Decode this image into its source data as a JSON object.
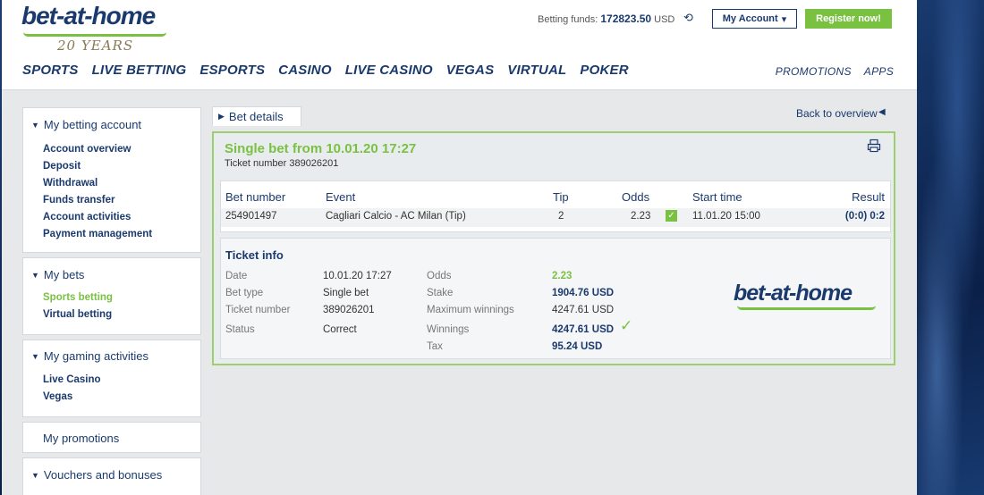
{
  "header": {
    "logo_text": "bet-at-home",
    "logo_years": "20 YEARS",
    "funds_label": "Betting funds:",
    "funds_value": "172823.50",
    "funds_currency": "USD",
    "my_account_label": "My Account",
    "register_label": "Register now!",
    "nav": [
      "SPORTS",
      "LIVE BETTING",
      "ESPORTS",
      "CASINO",
      "LIVE CASINO",
      "VEGAS",
      "VIRTUAL",
      "POKER"
    ],
    "nav_right": [
      "PROMOTIONS",
      "APPS"
    ]
  },
  "sidebar": {
    "betting_account": {
      "title": "My betting account",
      "items": [
        "Account overview",
        "Deposit",
        "Withdrawal",
        "Funds transfer",
        "Account activities",
        "Payment management"
      ]
    },
    "my_bets": {
      "title": "My bets",
      "items": [
        "Sports betting",
        "Virtual betting"
      ],
      "active_index": 0
    },
    "gaming": {
      "title": "My gaming activities",
      "items": [
        "Live Casino",
        "Vegas"
      ]
    },
    "promotions": {
      "title": "My promotions"
    },
    "vouchers": {
      "title": "Vouchers and bonuses"
    }
  },
  "main": {
    "tab_label": "Bet details",
    "back_label": "Back to overview",
    "title": "Single bet from 10.01.20 17:27",
    "ticket_line": "Ticket number 389026201",
    "bets_table": {
      "headers": [
        "Bet number",
        "Event",
        "Tip",
        "Odds",
        "Start time",
        "Result"
      ],
      "rows": [
        {
          "bet_number": "254901497",
          "event": "Cagliari Calcio - AC Milan (Tip)",
          "tip": "2",
          "odds": "2.23",
          "won": true,
          "start_time": "11.01.20 15:00",
          "result": "(0:0) 0:2"
        }
      ]
    },
    "ticket_info": {
      "title": "Ticket info",
      "left": [
        {
          "label": "Date",
          "value": "10.01.20 17:27"
        },
        {
          "label": "Bet type",
          "value": "Single bet"
        },
        {
          "label": "Ticket number",
          "value": "389026201"
        },
        {
          "label": "Status",
          "value": "Correct"
        }
      ],
      "right": [
        {
          "label": "Odds",
          "value": "2.23"
        },
        {
          "label": "Stake",
          "value": "1904.76 USD"
        },
        {
          "label": "Maximum winnings",
          "value": "4247.61 USD"
        },
        {
          "label": "Winnings",
          "value": "4247.61 USD"
        },
        {
          "label": "Tax",
          "value": "95.24 USD"
        }
      ],
      "brand": "bet-at-home"
    }
  },
  "colors": {
    "brand_blue": "#1a3a6e",
    "brand_green": "#7ac142"
  }
}
